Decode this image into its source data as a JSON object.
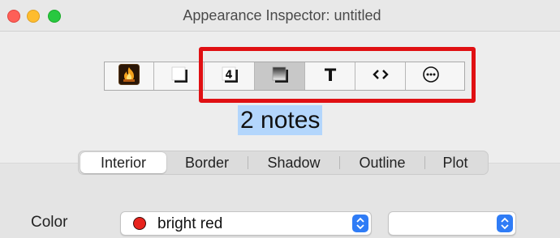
{
  "window": {
    "title": "Appearance Inspector: untitled"
  },
  "toolbar": {
    "buttons": [
      {
        "icon": "flame-icon"
      },
      {
        "icon": "shadowed-square-icon"
      },
      {
        "icon": "number-4-icon"
      },
      {
        "icon": "fill-gradient-icon",
        "pressed": true
      },
      {
        "icon": "text-T-icon"
      },
      {
        "icon": "code-brackets-icon"
      },
      {
        "icon": "more-ellipsis-icon"
      }
    ],
    "highlight_color": "#e01013"
  },
  "selection": {
    "label": "2 notes"
  },
  "tabs": [
    {
      "label": "Interior",
      "active": true
    },
    {
      "label": "Border"
    },
    {
      "label": "Shadow"
    },
    {
      "label": "Outline"
    },
    {
      "label": "Plot"
    }
  ],
  "form": {
    "color_label": "Color",
    "color_value": "bright red",
    "color_swatch": "#e8231d",
    "second_value": ""
  }
}
